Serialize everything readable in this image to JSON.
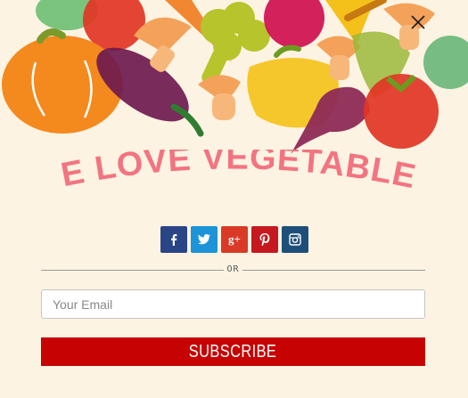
{
  "popup": {
    "headline": "WE LOVE VEGETABLES",
    "separator_text": "OR",
    "email_placeholder": "Your Email",
    "email_value": "",
    "subscribe_label": "SUBSCRIBE"
  },
  "social": [
    {
      "name": "facebook",
      "glyph": "f",
      "color": "#2a4586"
    },
    {
      "name": "twitter",
      "glyph": "t",
      "color": "#1d94d8"
    },
    {
      "name": "google-plus",
      "glyph": "g+",
      "color": "#d93a27"
    },
    {
      "name": "pinterest",
      "glyph": "p",
      "color": "#c5181f"
    },
    {
      "name": "instagram",
      "glyph": "camera",
      "color": "#1e4f79"
    }
  ],
  "colors": {
    "background": "#fcf3e2",
    "headline": "#f37480",
    "subscribe": "#c70202"
  }
}
